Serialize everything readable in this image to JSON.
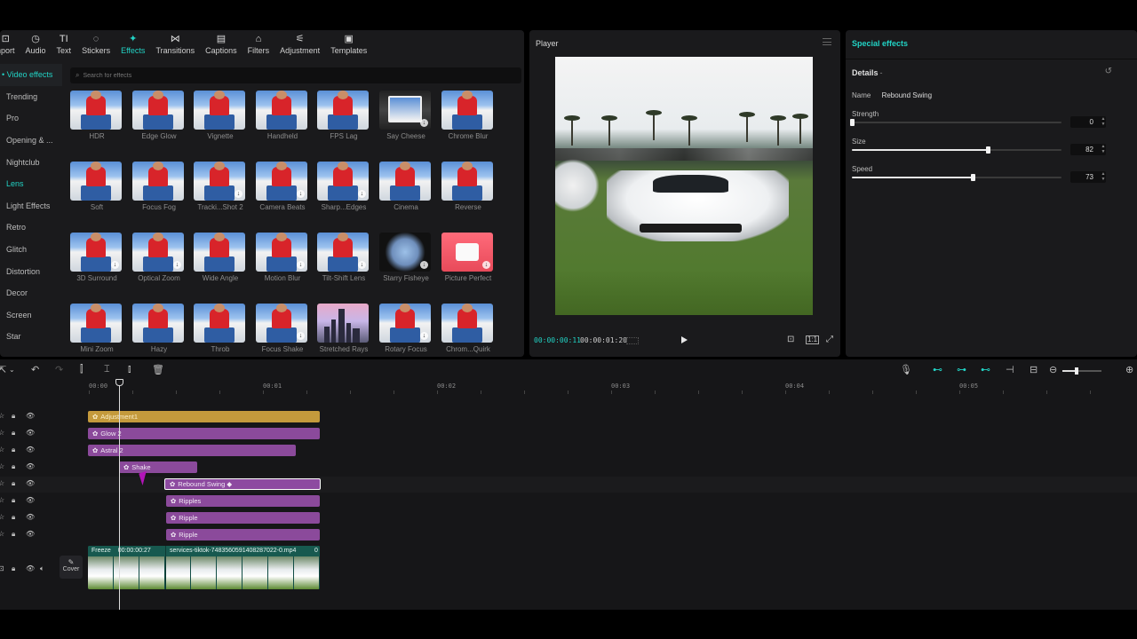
{
  "toolbar": {
    "items": [
      {
        "label": "nport",
        "icon": "import-icon",
        "glyph": "⊡"
      },
      {
        "label": "Audio",
        "icon": "audio-icon",
        "glyph": "◷"
      },
      {
        "label": "Text",
        "icon": "text-icon",
        "glyph": "TI"
      },
      {
        "label": "Stickers",
        "icon": "stickers-icon",
        "glyph": "◌"
      },
      {
        "label": "Effects",
        "icon": "effects-icon",
        "glyph": "✦"
      },
      {
        "label": "Transitions",
        "icon": "transitions-icon",
        "glyph": "⋈"
      },
      {
        "label": "Captions",
        "icon": "captions-icon",
        "glyph": "▤"
      },
      {
        "label": "Filters",
        "icon": "filters-icon",
        "glyph": "⌂"
      },
      {
        "label": "Adjustment",
        "icon": "adjustment-icon",
        "glyph": "⚟"
      },
      {
        "label": "Templates",
        "icon": "templates-icon",
        "glyph": "▣"
      }
    ],
    "active": "Effects",
    "accent": "#22d3c5"
  },
  "sidebar": {
    "header": "• Video effects",
    "items": [
      "Trending",
      "Pro",
      "Opening & ...",
      "Nightclub",
      "Lens",
      "Light Effects",
      "Retro",
      "Glitch",
      "Distortion",
      "Decor",
      "Screen",
      "Star"
    ],
    "active": "Lens"
  },
  "search": {
    "placeholder": "Search for effects"
  },
  "effects": [
    {
      "name": "HDR",
      "style": "person"
    },
    {
      "name": "Edge Glow",
      "style": "person"
    },
    {
      "name": "Vignette",
      "style": "person"
    },
    {
      "name": "Handheld",
      "style": "person"
    },
    {
      "name": "FPS Lag",
      "style": "person"
    },
    {
      "name": "Say Cheese",
      "style": "dark"
    },
    {
      "name": "Chrome Blur",
      "style": "person"
    },
    {
      "name": "Soft",
      "style": "person"
    },
    {
      "name": "Focus Fog",
      "style": "person"
    },
    {
      "name": "Tracki...Shot 2",
      "style": "person"
    },
    {
      "name": "Camera Beats",
      "style": "person"
    },
    {
      "name": "Sharp...Edges",
      "style": "person"
    },
    {
      "name": "Cinema",
      "style": "person"
    },
    {
      "name": "Reverse",
      "style": "person"
    },
    {
      "name": "3D Surround",
      "style": "person"
    },
    {
      "name": "Optical Zoom",
      "style": "person"
    },
    {
      "name": "Wide Angle",
      "style": "person"
    },
    {
      "name": "Motion Blur",
      "style": "person"
    },
    {
      "name": "Tilt-Shift Lens",
      "style": "person"
    },
    {
      "name": "Starry Fisheye",
      "style": "sphere"
    },
    {
      "name": "Picture Perfect",
      "style": "red"
    },
    {
      "name": "Mini Zoom",
      "style": "person"
    },
    {
      "name": "Hazy",
      "style": "person"
    },
    {
      "name": "Throb",
      "style": "person"
    },
    {
      "name": "Focus Shake",
      "style": "person"
    },
    {
      "name": "Stretched Rays",
      "style": "city"
    },
    {
      "name": "Rotary Focus",
      "style": "person"
    },
    {
      "name": "Chrom...Quirk",
      "style": "person"
    }
  ],
  "player": {
    "title": "Player",
    "current_time": "00:00:00:11",
    "total_time": "00:00:01:20"
  },
  "properties": {
    "title": "Special effects",
    "details_label": "Details",
    "name_label": "Name",
    "name_value": "Rebound Swing",
    "params": [
      {
        "label": "Strength",
        "value": 0,
        "max": 100
      },
      {
        "label": "Size",
        "value": 82,
        "max": 100
      },
      {
        "label": "Speed",
        "value": 73,
        "max": 100
      }
    ]
  },
  "timeline": {
    "ruler": [
      "00:00",
      "00:01",
      "00:02",
      "00:03",
      "00:04",
      "00:05"
    ],
    "cover_label": "Cover",
    "tracks": [
      {
        "name": "Adjustment1",
        "type": "gold"
      },
      {
        "name": "Glow 2",
        "type": "purple"
      },
      {
        "name": "Astral 2",
        "type": "purple"
      },
      {
        "name": "Shake",
        "type": "purple"
      },
      {
        "name": "Rebound Swing ◆",
        "type": "selected"
      },
      {
        "name": "Ripples",
        "type": "purple"
      },
      {
        "name": "Ripple",
        "type": "purple"
      },
      {
        "name": "Ripple",
        "type": "purple"
      }
    ],
    "video_clip": {
      "freeze_label": "Freeze",
      "freeze_duration": "00:00:00:27",
      "file_name": "services-tiktok-7483560591408287022-0.mp4",
      "tail": "0"
    }
  }
}
